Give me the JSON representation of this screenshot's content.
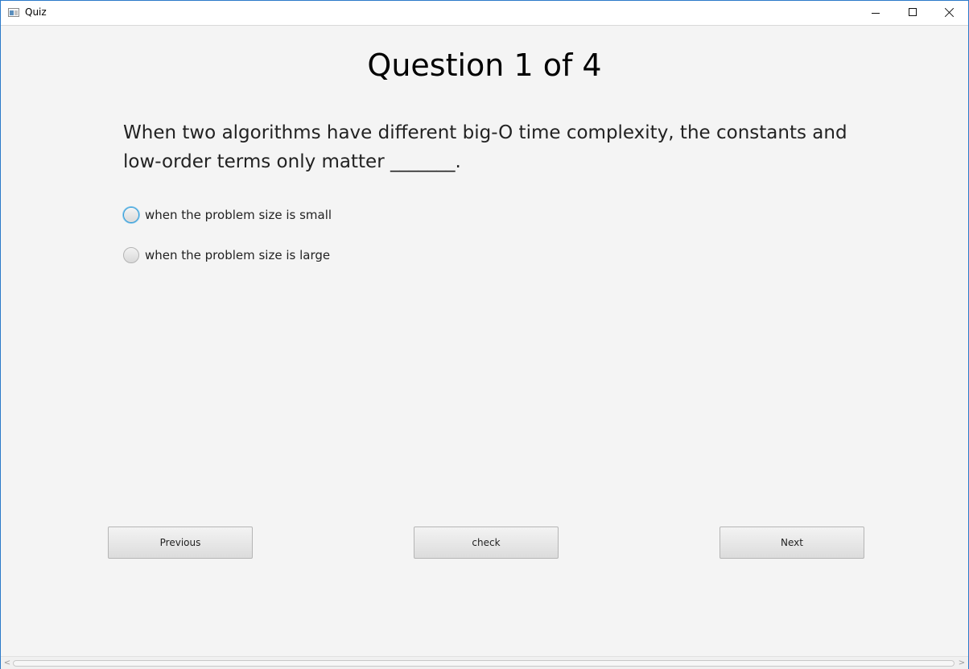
{
  "window": {
    "title": "Quiz",
    "accent_color": "#2b79c9",
    "icons": {
      "app": "app-window-icon",
      "minimize": "minimize-icon",
      "maximize": "maximize-icon",
      "close": "close-icon"
    }
  },
  "quiz": {
    "heading": "Question 1 of 4",
    "question_line1": "When two algorithms have different big-O time complexity, the constants and",
    "question_line2": "low-order terms only matter _______.",
    "options": [
      {
        "label": "when the problem size is small",
        "selected": false,
        "focused": true
      },
      {
        "label": "when the problem size is large",
        "selected": false,
        "focused": false
      }
    ]
  },
  "buttons": {
    "previous": "Previous",
    "check": "check",
    "next": "Next"
  },
  "scrollbar": {
    "left_arrow": "<",
    "right_arrow": ">"
  }
}
